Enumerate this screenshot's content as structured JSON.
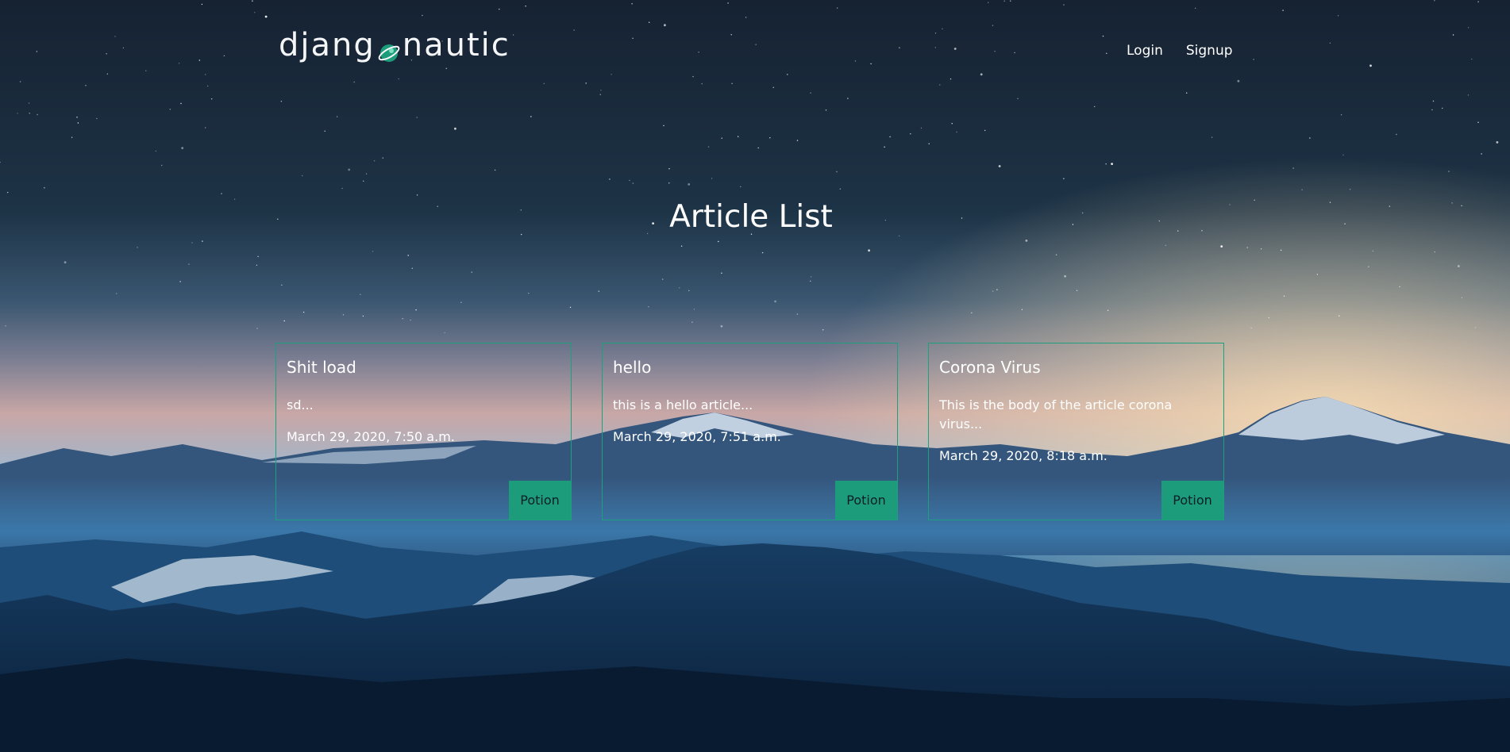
{
  "header": {
    "logo_left": "djang",
    "logo_right": "nautic",
    "nav": [
      {
        "label": "Login"
      },
      {
        "label": "Signup"
      }
    ]
  },
  "page": {
    "title": "Article List"
  },
  "articles": [
    {
      "title": "Shit load",
      "snippet": "sd...",
      "date": "March 29, 2020, 7:50 a.m.",
      "button_label": "Potion"
    },
    {
      "title": "hello",
      "snippet": "this is a hello article...",
      "date": "March 29, 2020, 7:51 a.m.",
      "button_label": "Potion"
    },
    {
      "title": "Corona Virus",
      "snippet": "This is the body of the article corona virus...",
      "date": "March 29, 2020, 8:18 a.m.",
      "button_label": "Potion"
    }
  ],
  "colors": {
    "accent": "#1d9c7c",
    "card_border": "#1e9f7e",
    "sky_top": "#162232",
    "sky_horizon": "#f1d7b3",
    "forest": "#0d2a4a"
  },
  "icons": {
    "logo_planet": "planet-icon"
  }
}
